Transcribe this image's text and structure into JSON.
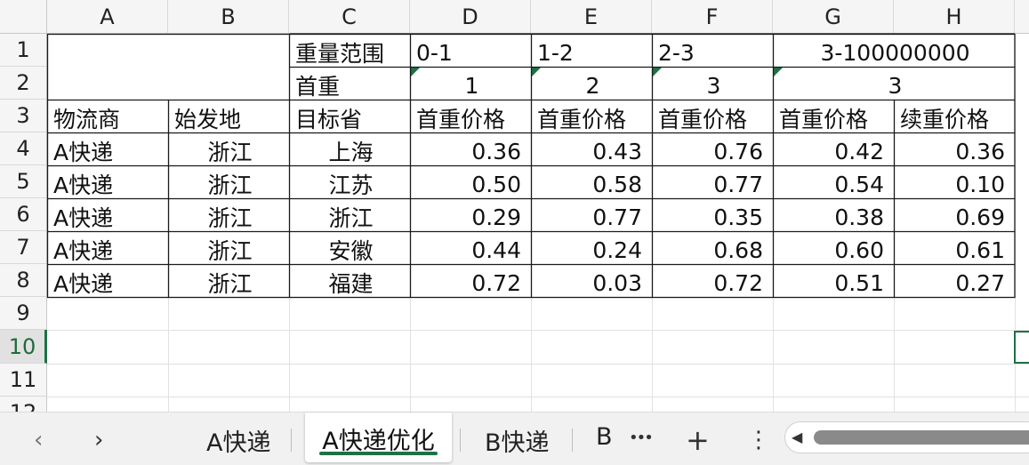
{
  "columns": [
    "A",
    "B",
    "C",
    "D",
    "E",
    "F",
    "G",
    "H"
  ],
  "rows": [
    "1",
    "2",
    "3",
    "4",
    "5",
    "6",
    "7",
    "8",
    "9",
    "10",
    "11",
    "12"
  ],
  "header_rows": {
    "weight_range_label": "重量范围",
    "ranges": [
      "0-1",
      "1-2",
      "2-3",
      "3-100000000"
    ],
    "first_weight_label": "首重",
    "first_weight_values": [
      "1",
      "2",
      "3",
      "3"
    ],
    "col_labels": [
      "物流商",
      "始发地",
      "目标省",
      "首重价格",
      "首重价格",
      "首重价格",
      "首重价格",
      "续重价格"
    ]
  },
  "table": [
    [
      "A快递",
      "浙江",
      "上海",
      "0.36",
      "0.43",
      "0.76",
      "0.42",
      "0.36"
    ],
    [
      "A快递",
      "浙江",
      "江苏",
      "0.50",
      "0.58",
      "0.77",
      "0.54",
      "0.10"
    ],
    [
      "A快递",
      "浙江",
      "浙江",
      "0.29",
      "0.77",
      "0.35",
      "0.38",
      "0.69"
    ],
    [
      "A快递",
      "浙江",
      "安徽",
      "0.44",
      "0.24",
      "0.68",
      "0.60",
      "0.61"
    ],
    [
      "A快递",
      "浙江",
      "福建",
      "0.72",
      "0.03",
      "0.72",
      "0.51",
      "0.27"
    ]
  ],
  "tabs": {
    "prev": "‹",
    "next": "›",
    "items": [
      "A快递",
      "A快递优化",
      "B快递",
      "B"
    ],
    "active_index": 1,
    "more": "•••",
    "add": "+",
    "menu": "⋮",
    "scroll_left": "◀"
  },
  "colors": {
    "accent": "#1e7145"
  }
}
